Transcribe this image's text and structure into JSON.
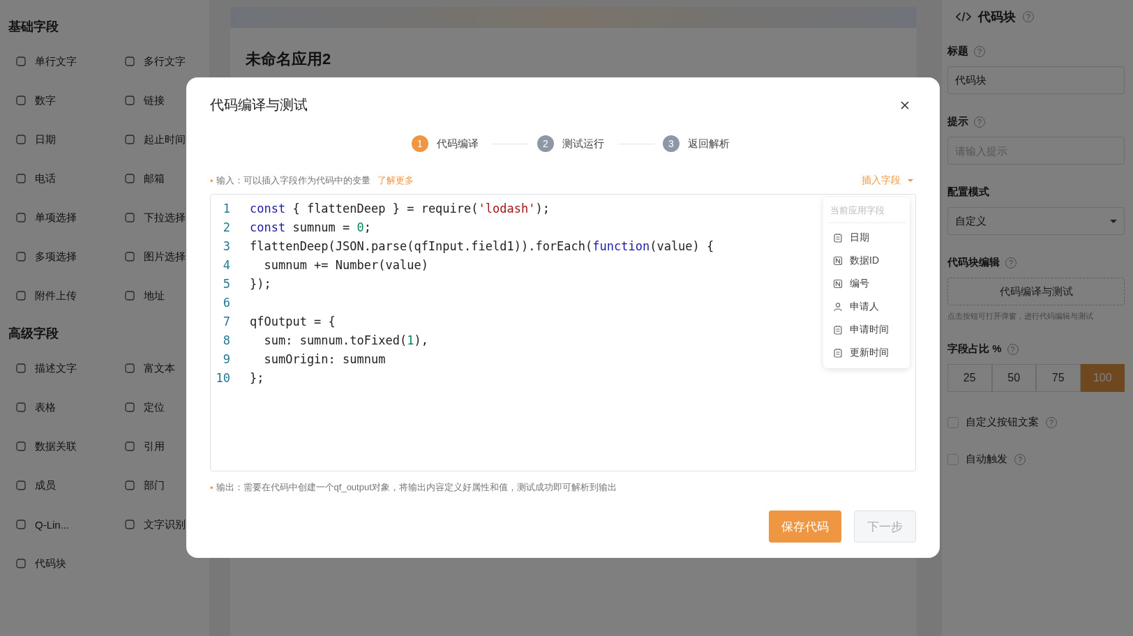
{
  "sidebar": {
    "groups": [
      {
        "title": "基础字段",
        "items": [
          {
            "label": "单行文字"
          },
          {
            "label": "多行文字"
          },
          {
            "label": "数字"
          },
          {
            "label": "链接"
          },
          {
            "label": "日期"
          },
          {
            "label": "起止时间"
          },
          {
            "label": "电话"
          },
          {
            "label": "邮箱"
          },
          {
            "label": "单项选择"
          },
          {
            "label": "下拉选择"
          },
          {
            "label": "多项选择"
          },
          {
            "label": "图片选择"
          },
          {
            "label": "附件上传"
          },
          {
            "label": "地址"
          }
        ]
      },
      {
        "title": "高级字段",
        "items": [
          {
            "label": "描述文字"
          },
          {
            "label": "富文本"
          },
          {
            "label": "表格"
          },
          {
            "label": "定位"
          },
          {
            "label": "数据关联"
          },
          {
            "label": "引用"
          },
          {
            "label": "成员"
          },
          {
            "label": "部门"
          },
          {
            "label": "Q-Lin..."
          },
          {
            "label": "文字识别"
          },
          {
            "label": "代码块"
          }
        ]
      }
    ]
  },
  "canvas": {
    "app_title": "未命名应用2"
  },
  "properties": {
    "title": "代码块",
    "title_help": "?",
    "title_field": {
      "label": "标题",
      "help": "?",
      "value": "代码块"
    },
    "hint_field": {
      "label": "提示",
      "help": "?",
      "placeholder": "请输入提示"
    },
    "mode_field": {
      "label": "配置模式",
      "value": "自定义"
    },
    "code_edit": {
      "label": "代码块编辑",
      "help": "?",
      "button": "代码编译与测试",
      "note": "点击按钮可打开弹窗，进行代码编辑与测试"
    },
    "width_ratio": {
      "label": "字段占比 %",
      "help": "?",
      "options": [
        {
          "label": "25",
          "selected": false
        },
        {
          "label": "50",
          "selected": false
        },
        {
          "label": "75",
          "selected": false
        },
        {
          "label": "100",
          "selected": true
        }
      ]
    },
    "options": [
      {
        "label": "自定义按钮文案",
        "help": "?",
        "checked": false
      },
      {
        "label": "自动触发",
        "help": "?",
        "checked": false
      }
    ]
  },
  "dialog": {
    "title": "代码编译与测试",
    "steps": [
      {
        "number": "1",
        "label": "代码编译",
        "selected": true
      },
      {
        "number": "2",
        "label": "测试运行",
        "selected": false
      },
      {
        "number": "3",
        "label": "返回解析",
        "selected": false
      }
    ],
    "input_hint": {
      "bullet": "•",
      "text": "输入：可以插入字段作为代码中的变量",
      "link": "了解更多"
    },
    "insert_field": {
      "label": "插入字段",
      "expanded": true,
      "menu_header": "当前应用字段",
      "items": [
        {
          "kind": "date",
          "label": "日期"
        },
        {
          "kind": "number",
          "label": "数据ID"
        },
        {
          "kind": "number",
          "label": "编号"
        },
        {
          "kind": "member",
          "label": "申请人"
        },
        {
          "kind": "date",
          "label": "申请时间"
        },
        {
          "kind": "date",
          "label": "更新时间"
        }
      ]
    },
    "code_lines": [
      {
        "number": "1",
        "tokens": [
          {
            "kind": "keyword",
            "text": "const"
          },
          {
            "kind": "plain",
            "text": " { flattenDeep } = require("
          },
          {
            "kind": "string",
            "text": "'lodash'"
          },
          {
            "kind": "plain",
            "text": ");"
          }
        ]
      },
      {
        "number": "2",
        "tokens": [
          {
            "kind": "keyword",
            "text": "const"
          },
          {
            "kind": "plain",
            "text": " sumnum = "
          },
          {
            "kind": "number",
            "text": "0"
          },
          {
            "kind": "plain",
            "text": ";"
          }
        ]
      },
      {
        "number": "3",
        "tokens": [
          {
            "kind": "plain",
            "text": "flattenDeep(JSON.parse(qfInput.field1)).forEach("
          },
          {
            "kind": "keyword",
            "text": "function"
          },
          {
            "kind": "plain",
            "text": "(value) {"
          }
        ]
      },
      {
        "number": "4",
        "tokens": [
          {
            "kind": "plain",
            "text": "  sumnum += Number(value)"
          }
        ]
      },
      {
        "number": "5",
        "tokens": [
          {
            "kind": "plain",
            "text": "});"
          }
        ]
      },
      {
        "number": "6"
      },
      {
        "number": "7",
        "tokens": [
          {
            "kind": "plain",
            "text": "qfOutput = {"
          }
        ]
      },
      {
        "number": "8",
        "tokens": [
          {
            "kind": "plain",
            "text": "  sum: sumnum.toFixed("
          },
          {
            "kind": "number",
            "text": "1"
          },
          {
            "kind": "plain",
            "text": "),"
          }
        ]
      },
      {
        "number": "9",
        "tokens": [
          {
            "kind": "plain",
            "text": "  sumOrigin: sumnum"
          }
        ]
      },
      {
        "number": "10",
        "tokens": [
          {
            "kind": "plain",
            "text": "};"
          }
        ]
      }
    ],
    "output_hint": {
      "bullet": "•",
      "text": "输出：需要在代码中创建一个qf_output对象，将输出内容定义好属性和值，测试成功即可解析到输出"
    },
    "buttons": [
      {
        "label": "保存代码",
        "kind": "primary"
      },
      {
        "label": "下一步",
        "kind": "disabled"
      }
    ]
  }
}
